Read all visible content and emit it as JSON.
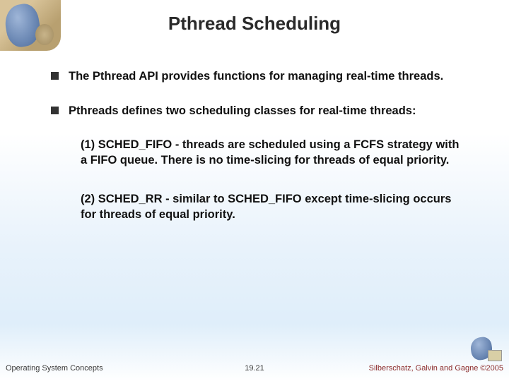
{
  "title": "Pthread Scheduling",
  "bullets": [
    "The Pthread API provides functions for managing real-time threads.",
    "Pthreads defines two scheduling classes for real-time threads:"
  ],
  "subpoints": [
    "(1) SCHED_FIFO - threads are scheduled using a FCFS strategy with a FIFO queue. There is no time-slicing for threads of equal priority.",
    "(2) SCHED_RR - similar to SCHED_FIFO except time-slicing occurs for threads of equal priority."
  ],
  "footer": {
    "left": "Operating System Concepts",
    "center": "19.21",
    "right": "Silberschatz, Galvin and Gagne ©2005"
  }
}
